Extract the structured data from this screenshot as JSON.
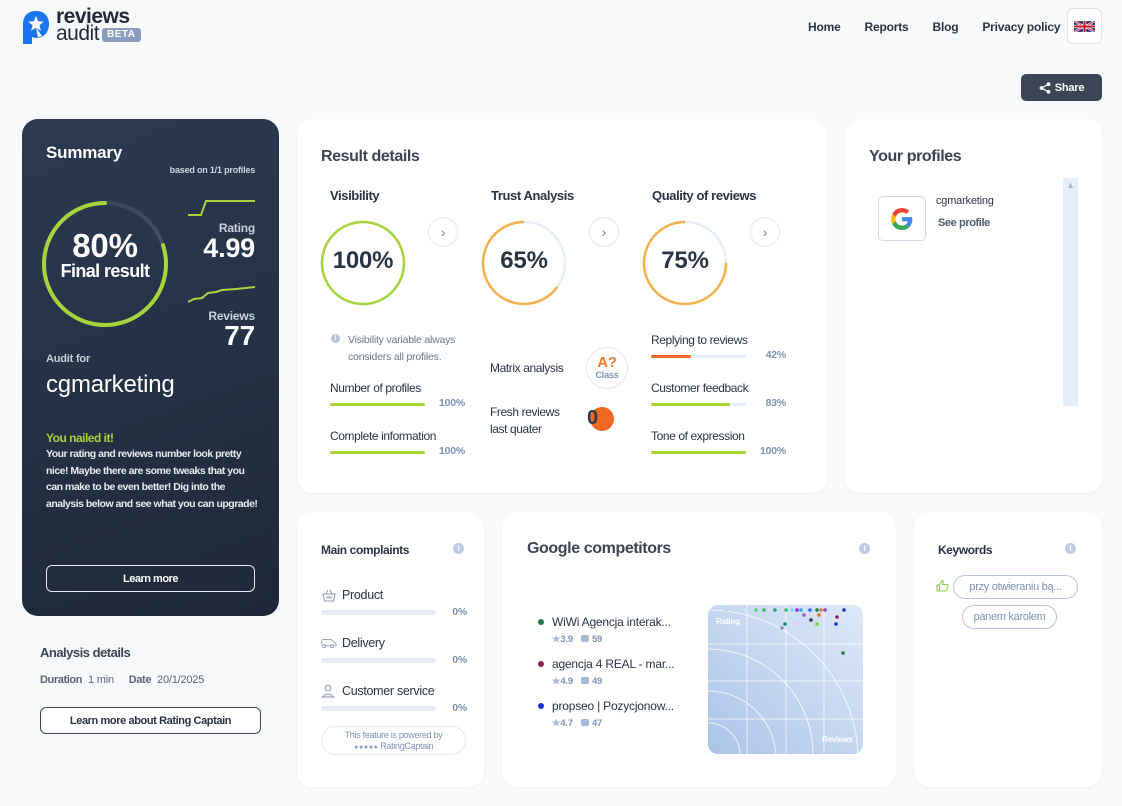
{
  "brand": {
    "line1": "reviews",
    "line2": "audit",
    "badge": "BETA"
  },
  "nav": {
    "items": [
      "Home",
      "Reports",
      "Blog",
      "Privacy policy"
    ],
    "language_icon": "uk-flag-icon"
  },
  "toolbar": {
    "share_label": "Share"
  },
  "summary": {
    "title": "Summary",
    "based_on": "based on 1/1 profiles",
    "final_percent": "80%",
    "final_value": 0.8,
    "final_label": "Final result",
    "rating_label": "Rating",
    "rating_value": "4.99",
    "reviews_label": "Reviews",
    "reviews_value": "77",
    "audit_for_label": "Audit for",
    "audit_name": "cgmarketing",
    "headline": "You nailed it!",
    "message": "Your rating and reviews number look pretty nice! Maybe there are some tweaks that you can make to be even better! Dig into the analysis below and see what you can upgrade!",
    "learn_more_label": "Learn more",
    "accent_color": "#a6d43d"
  },
  "analysis": {
    "title": "Analysis details",
    "duration_label": "Duration",
    "duration_value": "1 min",
    "date_label": "Date",
    "date_value": "20/1/2025",
    "button_label": "Learn more about Rating Captain"
  },
  "results": {
    "title": "Result details",
    "columns": [
      {
        "heading": "Visibility",
        "percent_text": "100%",
        "value": 1.0,
        "color": "#a6d43d"
      },
      {
        "heading": "Trust Analysis",
        "percent_text": "65%",
        "value": 0.65,
        "color": "#f7b04a"
      },
      {
        "heading": "Quality of reviews",
        "percent_text": "75%",
        "value": 0.75,
        "color": "#f7b04a"
      }
    ],
    "visibility_note": "Visibility variable always considers all profiles.",
    "visibility_metrics": [
      {
        "label": "Number of profiles",
        "percent_text": "100%",
        "value": 1.0,
        "color": "#a6d43d"
      },
      {
        "label": "Complete information",
        "percent_text": "100%",
        "value": 1.0,
        "color": "#a6d43d"
      }
    ],
    "matrix_label": "Matrix analysis",
    "matrix_grade": "A?",
    "matrix_class": "Class",
    "fresh_label": "Fresh reviews last quater",
    "fresh_value": "0",
    "quality_metrics": [
      {
        "label": "Replying to reviews",
        "percent_text": "42%",
        "value": 0.42,
        "color": "#f06a24"
      },
      {
        "label": "Customer feedback",
        "percent_text": "83%",
        "value": 0.83,
        "color": "#a6d43d"
      },
      {
        "label": "Tone of expression",
        "percent_text": "100%",
        "value": 1.0,
        "color": "#a6d43d"
      }
    ]
  },
  "profiles": {
    "title": "Your profiles",
    "items": [
      {
        "name": "cgmarketing",
        "link_label": "See profile",
        "platform": "google"
      }
    ]
  },
  "complaints": {
    "title": "Main complaints",
    "items": [
      {
        "label": "Product",
        "percent_text": "0%",
        "icon": "basket-icon"
      },
      {
        "label": "Delivery",
        "percent_text": "0%",
        "icon": "van-icon"
      },
      {
        "label": "Customer service",
        "percent_text": "0%",
        "icon": "user-icon"
      }
    ],
    "powered_line1": "This feature is powered by",
    "powered_stars": "★★★★★",
    "powered_brand": "RatingCaptain"
  },
  "competitors": {
    "title": "Google competitors",
    "items": [
      {
        "name": "WiWi Agencja interak...",
        "rating": "3.9",
        "reviews": "59",
        "color": "#1e7a4c"
      },
      {
        "name": "agencja 4 REAL - mar...",
        "rating": "4.9",
        "reviews": "49",
        "color": "#8a1f5a"
      },
      {
        "name": "propseo | Pozycjonow...",
        "rating": "4.7",
        "reviews": "47",
        "color": "#1a2fd0"
      }
    ],
    "chart_x_label": "Reviews",
    "chart_y_label": "Rating"
  },
  "keywords": {
    "title": "Keywords",
    "items": [
      "przy otwieraniu bą...",
      "panem karolem"
    ]
  }
}
